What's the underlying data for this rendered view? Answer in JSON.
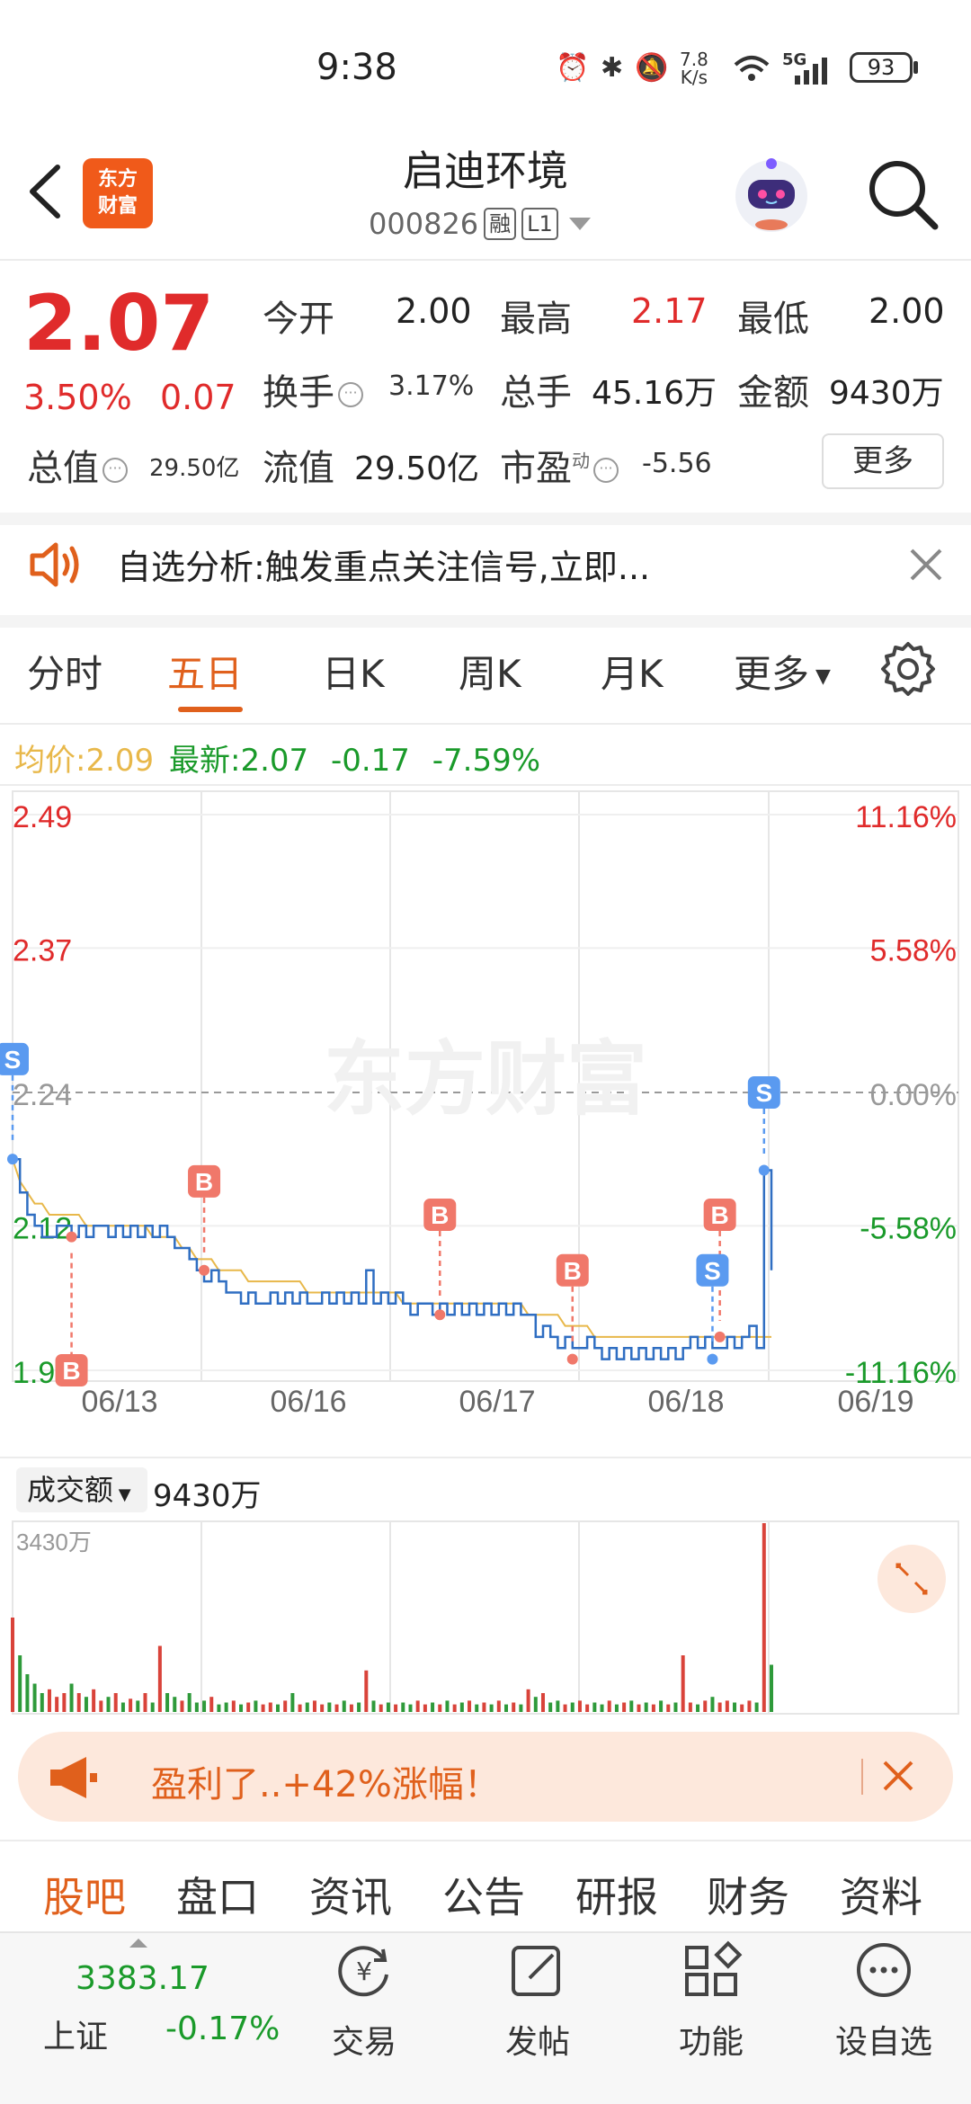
{
  "status_bar": {
    "time": "9:38",
    "net_speed_top": "7.8",
    "net_speed_bottom": "K/s",
    "network": "5G",
    "battery": "93"
  },
  "header": {
    "logo_line1": "东方",
    "logo_line2": "财富",
    "stock_name": "启迪环境",
    "stock_code": "000826",
    "tag_margin": "融",
    "tag_level": "L1"
  },
  "quote": {
    "price": "2.07",
    "change_pct": "3.50%",
    "change_val": "0.07",
    "open_label": "今开",
    "open": "2.00",
    "high_label": "最高",
    "high": "2.17",
    "low_label": "最低",
    "low": "2.00",
    "turnover_label": "换手",
    "turnover": "3.17%",
    "volume_label": "总手",
    "volume": "45.16万",
    "amount_label": "金额",
    "amount": "9430万",
    "total_mv_label": "总值",
    "total_mv": "29.50亿",
    "float_mv_label": "流值",
    "float_mv": "29.50亿",
    "pe_label": "市盈",
    "pe_sup": "动",
    "pe": "-5.56",
    "more_label": "更多"
  },
  "notice": {
    "text": "自选分析:触发重点关注信号,立即..."
  },
  "chart_tabs": [
    "分时",
    "五日",
    "日K",
    "周K",
    "月K",
    "更多"
  ],
  "active_chart_tab": "五日",
  "info_row": {
    "avg": "均价:2.09",
    "latest": "最新:2.07",
    "chg": "-0.17",
    "chg_pct": "-7.59%"
  },
  "colors": {
    "red": "#e02b2b",
    "green": "#1a9a2a",
    "line": "#2f6ec2",
    "avg": "#e8b84a",
    "accent": "#e0601c"
  },
  "watermark": "东方财富",
  "chart_data": {
    "type": "line",
    "y_labels_left": [
      "2.49",
      "2.37",
      "2.24",
      "2.12",
      "1.99"
    ],
    "y_labels_right": [
      "11.16%",
      "5.58%",
      "0.00%",
      "-5.58%",
      "-11.16%"
    ],
    "ylim": [
      1.99,
      2.49
    ],
    "ref_price": 2.24,
    "x_labels": [
      "06/13",
      "06/16",
      "06/17",
      "06/18",
      "06/19"
    ],
    "series": [
      {
        "name": "",
        "values": [
          2.18,
          2.15,
          2.13,
          2.12,
          2.11,
          2.11,
          2.12,
          2.12,
          2.11,
          2.12,
          2.11,
          2.12,
          2.12,
          2.11,
          2.12,
          2.11,
          2.12,
          2.11,
          2.12,
          2.11,
          2.12,
          2.11,
          2.1,
          2.1,
          2.09,
          2.08,
          2.07,
          2.08,
          2.07,
          2.06,
          2.06,
          2.05,
          2.06,
          2.05,
          2.05,
          2.06,
          2.05,
          2.06,
          2.05,
          2.06,
          2.05,
          2.05,
          2.06,
          2.05,
          2.06,
          2.05,
          2.06,
          2.05,
          2.08,
          2.05,
          2.06,
          2.05,
          2.06,
          2.05,
          2.04,
          2.05,
          2.05,
          2.04,
          2.05,
          2.04,
          2.05,
          2.04,
          2.05,
          2.04,
          2.05,
          2.04,
          2.05,
          2.04,
          2.05,
          2.04,
          2.04,
          2.02,
          2.03,
          2.02,
          2.01,
          2.02,
          2.01,
          2.01,
          2.02,
          2.01,
          2.0,
          2.01,
          2.0,
          2.01,
          2.0,
          2.01,
          2.0,
          2.01,
          2.0,
          2.01,
          2.0,
          2.01,
          2.02,
          2.01,
          2.02,
          2.01,
          2.01,
          2.02,
          2.01,
          2.02,
          2.03,
          2.01,
          2.17,
          2.08
        ]
      },
      {
        "name": "",
        "values": [
          2.18,
          2.16,
          2.15,
          2.14,
          2.14,
          2.13,
          2.13,
          2.13,
          2.13,
          2.13,
          2.12,
          2.12,
          2.12,
          2.12,
          2.12,
          2.12,
          2.12,
          2.12,
          2.12,
          2.11,
          2.11,
          2.11,
          2.11,
          2.1,
          2.1,
          2.09,
          2.09,
          2.09,
          2.08,
          2.08,
          2.08,
          2.08,
          2.07,
          2.07,
          2.07,
          2.07,
          2.07,
          2.07,
          2.07,
          2.07,
          2.06,
          2.06,
          2.06,
          2.06,
          2.06,
          2.06,
          2.06,
          2.06,
          2.06,
          2.06,
          2.06,
          2.06,
          2.06,
          2.05,
          2.05,
          2.05,
          2.05,
          2.05,
          2.05,
          2.05,
          2.05,
          2.05,
          2.05,
          2.05,
          2.05,
          2.05,
          2.05,
          2.05,
          2.05,
          2.05,
          2.04,
          2.04,
          2.04,
          2.04,
          2.04,
          2.03,
          2.03,
          2.03,
          2.03,
          2.02,
          2.02,
          2.02,
          2.02,
          2.02,
          2.02,
          2.02,
          2.02,
          2.02,
          2.02,
          2.02,
          2.02,
          2.02,
          2.02,
          2.02,
          2.02,
          2.02,
          2.02,
          2.02,
          2.02,
          2.02,
          2.02,
          2.02,
          2.02,
          2.02
        ]
      }
    ],
    "signals": [
      {
        "label": "S",
        "x_index": 0,
        "price": 2.18,
        "top_price": 2.27,
        "kind": "sell"
      },
      {
        "label": "B",
        "x_index": 8,
        "price": 2.11,
        "top_price": 1.99,
        "kind": "buy"
      },
      {
        "label": "B",
        "x_index": 26,
        "price": 2.08,
        "top_price": 2.16,
        "kind": "buy"
      },
      {
        "label": "B",
        "x_index": 58,
        "price": 2.04,
        "top_price": 2.13,
        "kind": "buy"
      },
      {
        "label": "B",
        "x_index": 76,
        "price": 2.0,
        "top_price": 2.08,
        "kind": "buy"
      },
      {
        "label": "B",
        "x_index": 96,
        "price": 2.02,
        "top_price": 2.13,
        "kind": "buy"
      },
      {
        "label": "S",
        "x_index": 95,
        "price": 2.0,
        "top_price": 2.08,
        "kind": "sell"
      },
      {
        "label": "S",
        "x_index": 102,
        "price": 2.17,
        "top_price": 2.24,
        "kind": "sell"
      }
    ]
  },
  "volume": {
    "selector_label": "成交额",
    "value": "9430万",
    "max_label": "3430万",
    "bars": [
      0.5,
      0.3,
      0.2,
      0.15,
      0.1,
      0.12,
      0.08,
      0.1,
      0.15,
      0.1,
      0.08,
      0.12,
      0.06,
      0.08,
      0.1,
      0.05,
      0.07,
      0.06,
      0.1,
      0.05,
      0.35,
      0.1,
      0.08,
      0.06,
      0.1,
      0.05,
      0.06,
      0.08,
      0.04,
      0.05,
      0.06,
      0.04,
      0.05,
      0.06,
      0.04,
      0.05,
      0.04,
      0.06,
      0.1,
      0.04,
      0.05,
      0.06,
      0.04,
      0.05,
      0.04,
      0.06,
      0.04,
      0.05,
      0.22,
      0.06,
      0.04,
      0.05,
      0.04,
      0.05,
      0.04,
      0.06,
      0.04,
      0.05,
      0.04,
      0.06,
      0.04,
      0.05,
      0.06,
      0.04,
      0.05,
      0.04,
      0.06,
      0.04,
      0.05,
      0.04,
      0.12,
      0.08,
      0.1,
      0.05,
      0.06,
      0.04,
      0.05,
      0.06,
      0.04,
      0.05,
      0.04,
      0.06,
      0.04,
      0.05,
      0.06,
      0.04,
      0.05,
      0.04,
      0.06,
      0.04,
      0.05,
      0.3,
      0.05,
      0.04,
      0.06,
      0.08,
      0.05,
      0.06,
      0.05,
      0.04,
      0.06,
      0.05,
      1.0,
      0.25
    ]
  },
  "promo": {
    "text": "盈利了..+42%涨幅！"
  },
  "section_tabs": [
    "股吧",
    "盘口",
    "资讯",
    "公告",
    "研报",
    "财务",
    "资料"
  ],
  "bottom_nav": {
    "index_value": "3383.17",
    "index_name": "上证",
    "index_chg": "-0.17%",
    "items": [
      "交易",
      "发帖",
      "功能",
      "设自选"
    ]
  }
}
